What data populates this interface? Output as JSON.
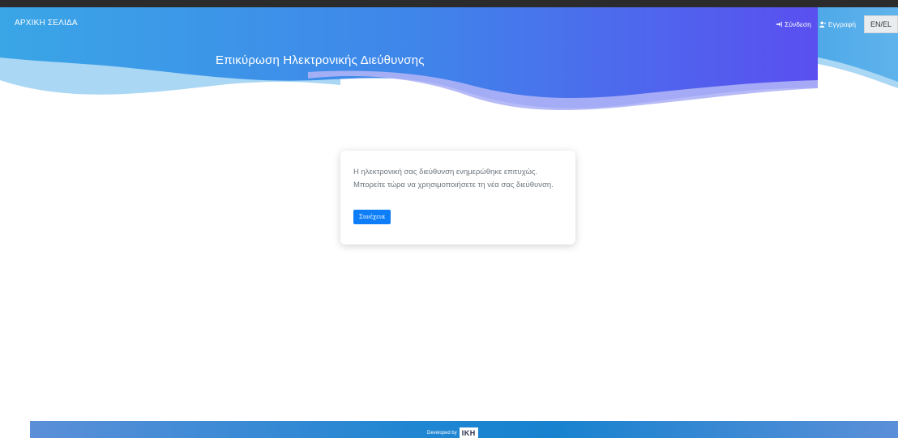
{
  "nav": {
    "home_label": "ΑΡΧΙΚΗ ΣΕΛΙΔΑ",
    "login_label": "Σύνδεση",
    "register_label": "Εγγραφή",
    "lang_label": "EN/EL"
  },
  "hero": {
    "title": "Επικύρωση Ηλεκτρονικής Διεύθυνσης"
  },
  "card": {
    "message": "Η ηλεκτρονική σας διεύθυνση ενημερώθηκε επιτυχώς. Μπορείτε τώρα να χρησιμοποιήσετε τη νέα σας διεύθυνση.",
    "continue_label": "Συνέχεια"
  },
  "footer": {
    "developed_by": "Developed by",
    "logo_text": "ΙΚΗ"
  },
  "colors": {
    "hero_gradient_start": "#3a9be0",
    "hero_gradient_end": "#5a4ff0",
    "primary_button": "#0d7ef8",
    "footer": "#1f86d2"
  }
}
